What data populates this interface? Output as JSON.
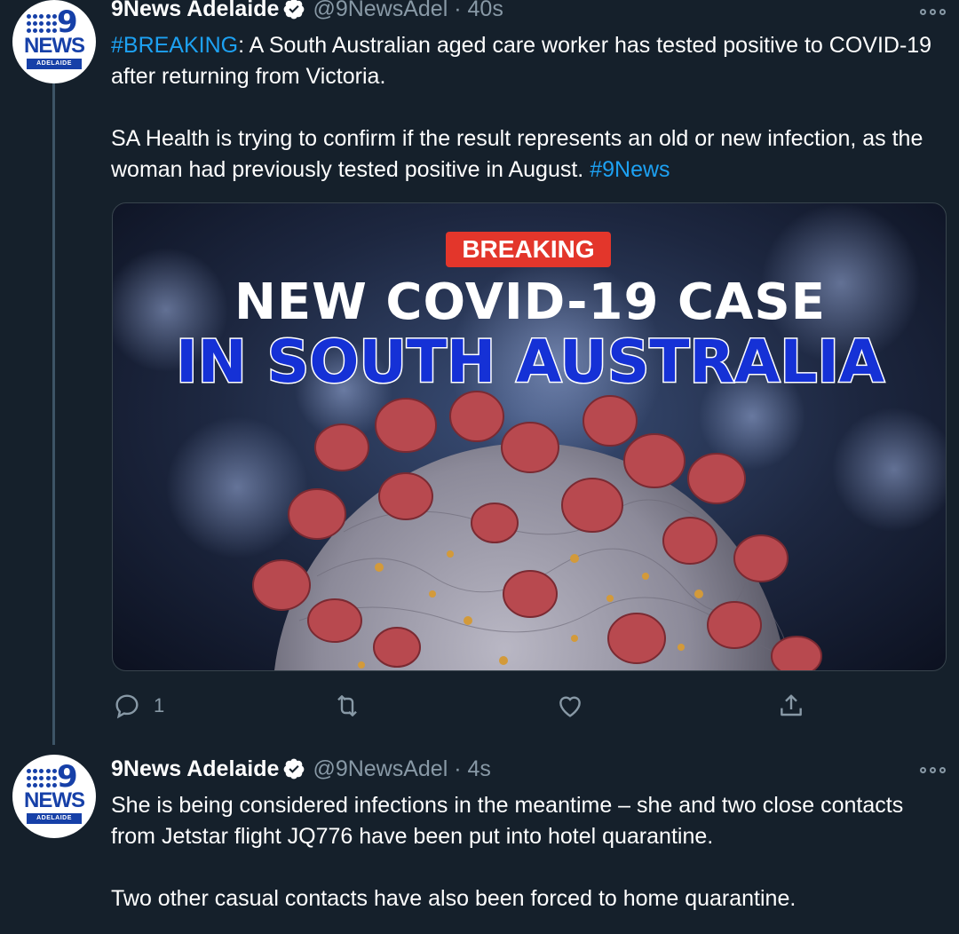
{
  "tweets": [
    {
      "author_name": "9News Adelaide",
      "handle": "@9NewsAdel",
      "separator": "·",
      "time": "40s",
      "body_segments": [
        {
          "hashtag": "#BREAKING",
          "text": ": A South Australian aged care worker has tested positive to COVID-19 after returning from Victoria."
        },
        {
          "text": "SA Health is trying to confirm if the result represents an old or new infection, as the woman had previously tested positive in August. ",
          "hashtag": "#9News"
        }
      ],
      "media": {
        "badge": "BREAKING",
        "headline_line1": "NEW COVID-19 CASE",
        "headline_line2": "IN SOUTH AUSTRALIA"
      },
      "actions": {
        "reply_count": "1",
        "retweet_count": "",
        "like_count": ""
      }
    },
    {
      "author_name": "9News Adelaide",
      "handle": "@9NewsAdel",
      "separator": "·",
      "time": "4s",
      "body_paragraphs": [
        "She is being considered infections in the meantime – she and two close contacts from Jetstar flight JQ776 have been put into hotel quarantine.",
        "Two other casual contacts have also been forced to home quarantine."
      ]
    }
  ],
  "avatar": {
    "number": "9",
    "word": "NEWS",
    "sub": "ADELAIDE",
    "brand_color": "#1640a8"
  },
  "colors": {
    "background": "#15202b",
    "link": "#1da1f2",
    "muted": "#8899a6",
    "breaking_red": "#e3362b",
    "headline_blue": "#1531d6"
  },
  "icons": [
    "verified-badge-icon",
    "more-options-icon",
    "reply-icon",
    "retweet-icon",
    "like-icon",
    "share-icon"
  ]
}
